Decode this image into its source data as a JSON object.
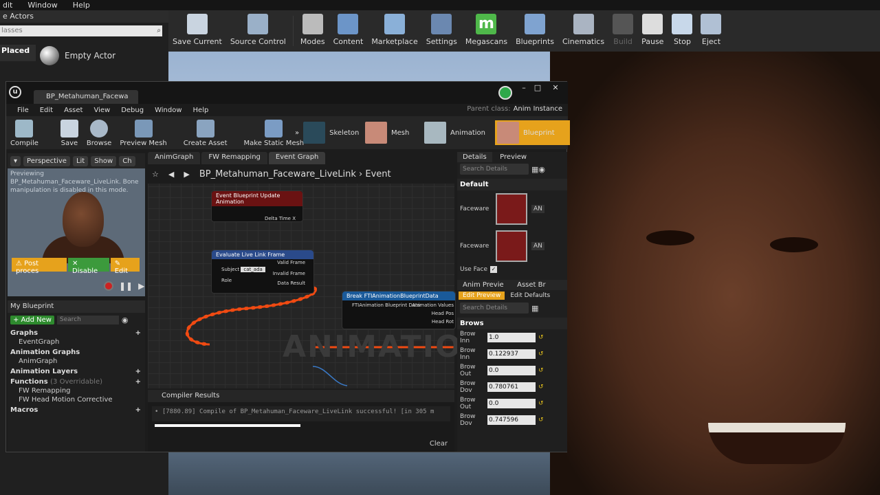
{
  "editor": {
    "menu": [
      "dit",
      "Window",
      "Help"
    ],
    "left_header": "e Actors",
    "classes_placeholder": "lasses",
    "placed_tab": "Placed",
    "empty_actor": "Empty Actor"
  },
  "toolbar": {
    "items": [
      {
        "label": "Save Current",
        "icon": "save-icon"
      },
      {
        "label": "Source Control",
        "icon": "source-control-icon"
      },
      {
        "label": "Modes",
        "icon": "modes-icon"
      },
      {
        "label": "Content",
        "icon": "content-icon"
      },
      {
        "label": "Marketplace",
        "icon": "marketplace-icon"
      },
      {
        "label": "Settings",
        "icon": "settings-icon"
      },
      {
        "label": "Megascans",
        "icon": "megascans-icon"
      },
      {
        "label": "Blueprints",
        "icon": "blueprints-icon"
      },
      {
        "label": "Cinematics",
        "icon": "cinematics-icon"
      },
      {
        "label": "Build",
        "icon": "build-icon"
      },
      {
        "label": "Pause",
        "icon": "pause-icon"
      },
      {
        "label": "Stop",
        "icon": "stop-icon"
      },
      {
        "label": "Eject",
        "icon": "eject-icon"
      }
    ]
  },
  "bp": {
    "tab_title": "BP_Metahuman_Facewa",
    "menu": [
      "File",
      "Edit",
      "Asset",
      "View",
      "Debug",
      "Window",
      "Help"
    ],
    "parent_class_label": "Parent class:",
    "parent_class_value": "Anim Instance",
    "tools": [
      {
        "label": "Compile"
      },
      {
        "label": "Save"
      },
      {
        "label": "Browse"
      },
      {
        "label": "Preview Mesh"
      },
      {
        "label": "Create Asset"
      },
      {
        "label": "Make Static Mesh"
      }
    ],
    "modes": [
      "Skeleton",
      "Mesh",
      "Animation",
      "Blueprint"
    ]
  },
  "preview": {
    "buttons": [
      "Perspective",
      "Lit",
      "Show",
      "Ch"
    ],
    "text": "Previewing BP_Metahuman_Faceware_LiveLink. Bone manipulation is disabled in this mode.",
    "post_process": "Post proces",
    "disable": "Disable",
    "edit": "Edit"
  },
  "mybp": {
    "title": "My Blueprint",
    "add_new": "+ Add New",
    "search": "Search",
    "graphs": "Graphs",
    "eventgraph": "EventGraph",
    "anim_graphs": "Animation Graphs",
    "animgraph": "AnimGraph",
    "anim_layers": "Animation Layers",
    "functions": "Functions",
    "overridable": "(3 Overridable)",
    "fn1": "FW Remapping",
    "fn2": "FW Head Motion Corrective",
    "macros": "Macros"
  },
  "graph": {
    "tabs": [
      "AnimGraph",
      "FW Remapping",
      "Event Graph"
    ],
    "breadcrumb": "BP_Metahuman_Faceware_LiveLink",
    "breadcrumb_tail": "Event",
    "node1": "Event Blueprint Update Animation",
    "node1_pin": "Delta Time X",
    "node2": "Evaluate Live Link Frame",
    "node2_subject": "Subject",
    "node2_subject_val": "cat_ada",
    "node2_role": "Role",
    "node2_valid": "Valid Frame",
    "node2_invalid": "Invalid Frame",
    "node2_data": "Data Result",
    "node3": "Break FTIAnimationBlueprintData",
    "node3_pin": "FTIAnimation Blueprint Data",
    "node3_out1": "Animation Values",
    "node3_out2": "Head Pos",
    "node3_out3": "Head Rot",
    "watermark": "ANIMATION"
  },
  "compiler": {
    "title": "Compiler Results",
    "message": "• [7880.89] Compile of BP_Metahuman_Faceware_LiveLink successful! [in 305 m",
    "clear": "Clear"
  },
  "details": {
    "tabs": [
      "Details",
      "Preview"
    ],
    "search": "Search Details",
    "default": "Default",
    "faceware1": "Faceware",
    "faceware2": "Faceware",
    "an": "AN",
    "use_face": "Use Face",
    "tabs2": [
      "Anim Previe",
      "Asset Br"
    ],
    "edit_preview": "Edit Preview",
    "edit_defaults": "Edit Defaults",
    "brows": "Brows",
    "props": [
      {
        "label": "Brow Inn",
        "value": "1.0"
      },
      {
        "label": "Brow Inn",
        "value": "0.122937"
      },
      {
        "label": "Brow Out",
        "value": "0.0"
      },
      {
        "label": "Brow Dov",
        "value": "0.780761"
      },
      {
        "label": "Brow Out",
        "value": "0.0"
      },
      {
        "label": "Brow Dov",
        "value": "0.747596"
      }
    ]
  },
  "colors": {
    "accent": "#e6a21c",
    "wire": "#f04a12",
    "green": "#2e8b2e"
  }
}
